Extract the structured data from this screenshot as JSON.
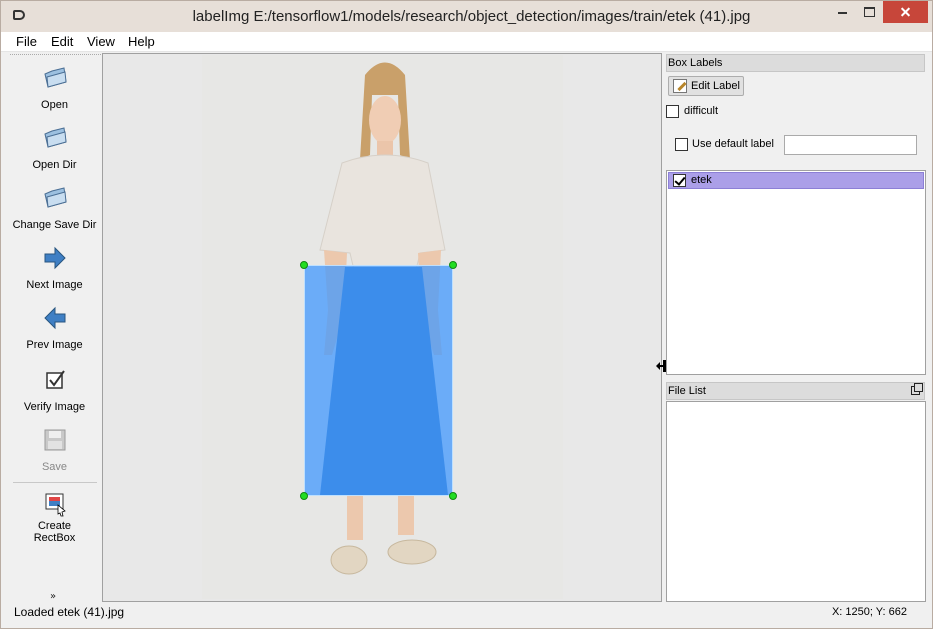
{
  "window": {
    "title": "labelImg E:/tensorflow1/models/research/object_detection/images/train/etek (41).jpg"
  },
  "menu": {
    "file": "File",
    "edit": "Edit",
    "view": "View",
    "help": "Help"
  },
  "toolbar": {
    "open": "Open",
    "open_dir": "Open Dir",
    "change_save_dir": "Change Save Dir",
    "next_image": "Next Image",
    "prev_image": "Prev Image",
    "verify_image": "Verify Image",
    "save": "Save",
    "create_rectbox_line1": "Create",
    "create_rectbox_line2": "RectBox",
    "overflow": "»"
  },
  "box_labels": {
    "title": "Box Labels",
    "edit_label": "Edit Label",
    "difficult": "difficult",
    "difficult_checked": false,
    "use_default_label": "Use default label",
    "use_default_checked": false,
    "default_label_value": "",
    "labels": [
      {
        "name": "etek",
        "checked": true,
        "color": "#ab9fe8"
      }
    ]
  },
  "file_list": {
    "title": "File List",
    "files": []
  },
  "status": {
    "message": "Loaded etek (41).jpg",
    "coords": "X: 1250; Y: 662"
  },
  "colors": {
    "bbox_fill": "#3c96ff",
    "handle": "#22dd22",
    "label_selected": "#ab9fe8",
    "close_button": "#c7463a"
  }
}
